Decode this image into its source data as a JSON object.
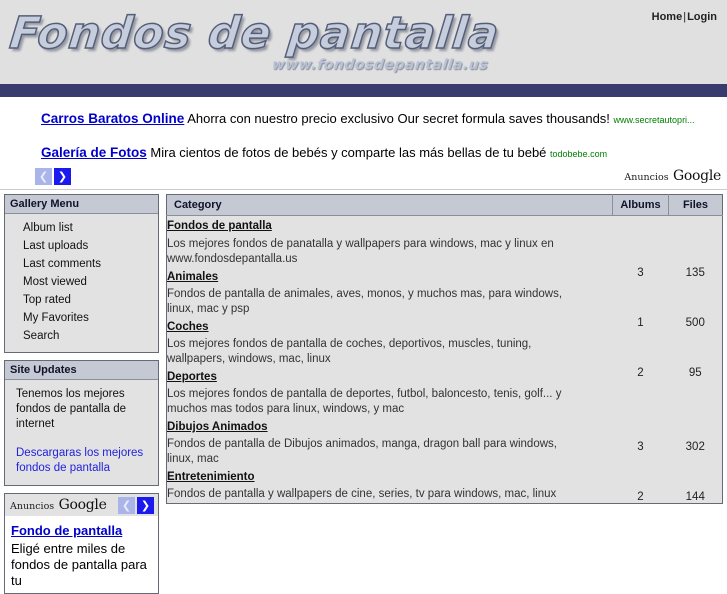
{
  "header": {
    "logo_text": "Fondos de pantalla",
    "logo_url": "www.fondosdepantalla.us",
    "home_label": "Home",
    "separator": "|",
    "login_label": "Login"
  },
  "top_ads": {
    "ads": [
      {
        "title": "Carros Baratos Online",
        "description": "Ahorra con nuestro precio exclusivo Our secret formula saves thousands!",
        "url": "www.secretautopri..."
      },
      {
        "title": "Galería de Fotos",
        "description": "Mira cientos de fotos de bebés y comparte las más bellas de tu bebé",
        "url": "todobebe.com"
      }
    ],
    "prev_arrow": "❮",
    "next_arrow": "❯",
    "branding_prefix": "Anuncios",
    "branding_name": "Google"
  },
  "sidebar": {
    "gallery_menu": {
      "title": "Gallery Menu",
      "items": [
        {
          "label": "Album list"
        },
        {
          "label": "Last uploads"
        },
        {
          "label": "Last comments"
        },
        {
          "label": "Most viewed"
        },
        {
          "label": "Top rated"
        },
        {
          "label": "My Favorites"
        },
        {
          "label": "Search"
        }
      ]
    },
    "site_updates": {
      "title": "Site Updates",
      "text": "Tenemos los mejores fondos de pantalla de internet",
      "link": "Descargaras los mejores fondos de pantalla"
    },
    "ad_block": {
      "branding_prefix": "Anuncios",
      "branding_name": "Google",
      "prev_arrow": "❮",
      "next_arrow": "❯",
      "title": "Fondo de pantalla",
      "description": "Eligé entre miles de fondos de pantalla para tu"
    }
  },
  "main": {
    "columns": {
      "category": "Category",
      "albums": "Albums",
      "files": "Files"
    },
    "root": {
      "title": "Fondos de pantalla",
      "description": "Los mejores fondos de panatalla y wallpapers para windows, mac y linux en www.fondosdepantalla.us"
    },
    "categories": [
      {
        "title": "Animales",
        "description": "Fondos de pantalla de animales, aves, monos, y muchos mas, para windows, linux, mac y psp",
        "albums": "3",
        "files": "135"
      },
      {
        "title": "Coches",
        "description": "Los mejores fondos de pantalla de coches, deportivos, muscles, tuning, wallpapers, windows, mac, linux",
        "albums": "1",
        "files": "500"
      },
      {
        "title": "Deportes",
        "description": "Los mejores fondos de pantalla de deportes, futbol, baloncesto, tenis, golf... y muchos mas todos para linux, windows, y mac",
        "albums": "2",
        "files": "95"
      },
      {
        "title": "Dibujos Animados",
        "description": "Fondos de pantalla de Dibujos animados, manga, dragon ball para windows, linux, mac",
        "albums": "3",
        "files": "302"
      },
      {
        "title": "Entretenimiento",
        "description": "Fondos de pantalla y wallpapers de cine, series, tv para windows, mac, linux",
        "albums": "2",
        "files": "144"
      }
    ]
  },
  "colors": {
    "navbar": "#373b6e",
    "panel_header": "#c4c9d4",
    "panel_body": "#e2e2e2",
    "link_blue": "#0000cc",
    "ad_url_green": "#008000"
  }
}
